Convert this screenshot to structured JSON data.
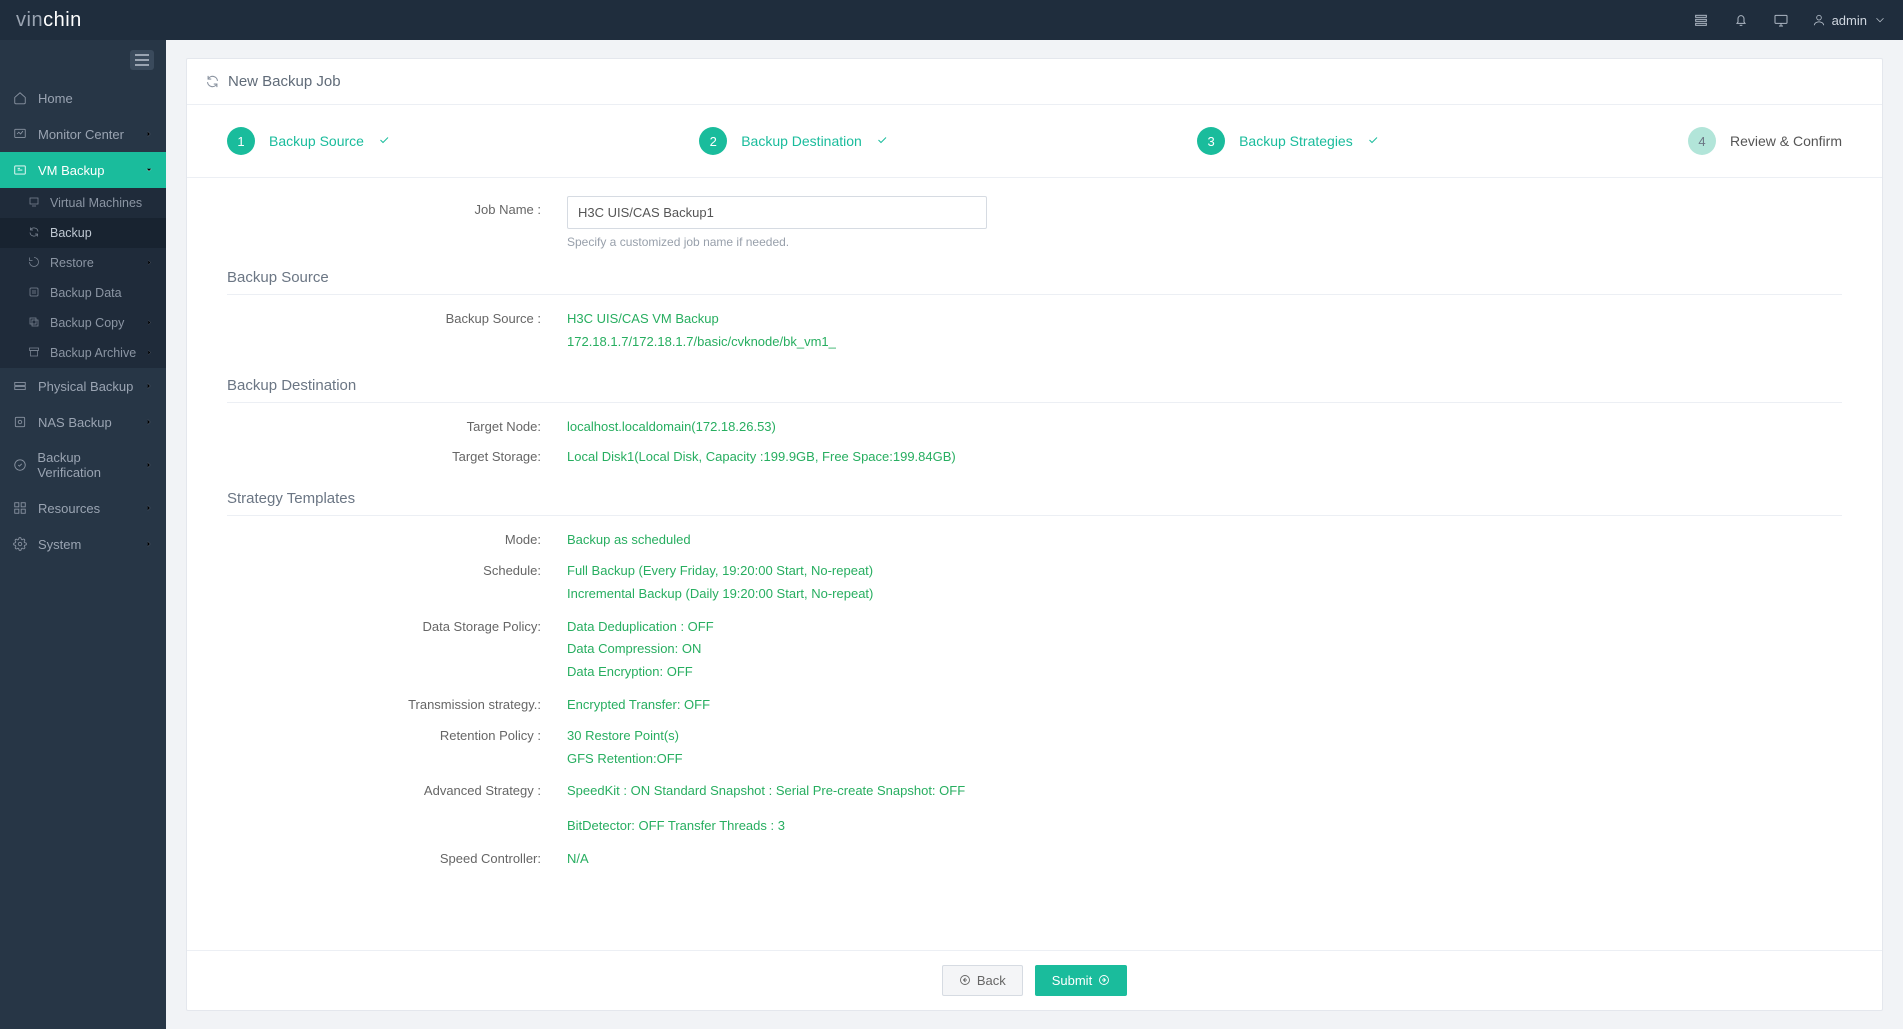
{
  "brand": {
    "p1": "vin",
    "p2": "chin"
  },
  "user": {
    "name": "admin"
  },
  "sidebar": {
    "items": [
      {
        "label": "Home"
      },
      {
        "label": "Monitor Center"
      },
      {
        "label": "VM Backup"
      },
      {
        "label": "Physical Backup"
      },
      {
        "label": "NAS Backup"
      },
      {
        "label": "Backup Verification"
      },
      {
        "label": "Resources"
      },
      {
        "label": "System"
      }
    ],
    "sub": [
      {
        "label": "Virtual Machines"
      },
      {
        "label": "Backup"
      },
      {
        "label": "Restore"
      },
      {
        "label": "Backup Data"
      },
      {
        "label": "Backup Copy"
      },
      {
        "label": "Backup Archive"
      }
    ]
  },
  "page": {
    "title": "New Backup Job"
  },
  "stepper": {
    "s1": {
      "num": "1",
      "label": "Backup Source"
    },
    "s2": {
      "num": "2",
      "label": "Backup Destination"
    },
    "s3": {
      "num": "3",
      "label": "Backup Strategies"
    },
    "s4": {
      "num": "4",
      "label": "Review & Confirm"
    }
  },
  "form": {
    "jobname_label": "Job Name :",
    "jobname_value": "H3C UIS/CAS Backup1",
    "jobname_help": "Specify a customized job name if needed."
  },
  "sections": {
    "source_title": "Backup Source",
    "dest_title": "Backup Destination",
    "strategy_title": "Strategy Templates"
  },
  "source": {
    "label": "Backup Source :",
    "l1": "H3C UIS/CAS VM Backup",
    "l2": "172.18.1.7/172.18.1.7/basic/cvknode/bk_vm1_"
  },
  "dest": {
    "node_label": "Target Node:",
    "node_value": "localhost.localdomain(172.18.26.53)",
    "storage_label": "Target Storage:",
    "storage_value": "Local Disk1(Local Disk, Capacity :199.9GB, Free Space:199.84GB)"
  },
  "strategy": {
    "mode_label": "Mode:",
    "mode_value": "Backup as scheduled",
    "sched_label": "Schedule:",
    "sched_l1": "Full Backup (Every Friday, 19:20:00 Start, No-repeat)",
    "sched_l2": "Incremental Backup (Daily 19:20:00 Start, No-repeat)",
    "dsp_label": "Data Storage Policy:",
    "dsp_l1": "Data Deduplication : OFF",
    "dsp_l2": "Data Compression: ON",
    "dsp_l3": "Data Encryption: OFF",
    "trans_label": "Transmission strategy.:",
    "trans_value": "Encrypted Transfer: OFF",
    "ret_label": "Retention Policy :",
    "ret_l1": "30 Restore Point(s)",
    "ret_l2": "GFS Retention:OFF",
    "adv_label": "Advanced Strategy :",
    "adv_l1": "SpeedKit : ON Standard Snapshot : Serial Pre-create Snapshot: OFF",
    "adv_l2": "BitDetector: OFF Transfer Threads : 3",
    "speed_label": "Speed Controller:",
    "speed_value": "N/A"
  },
  "footer": {
    "back": "Back",
    "submit": "Submit"
  }
}
